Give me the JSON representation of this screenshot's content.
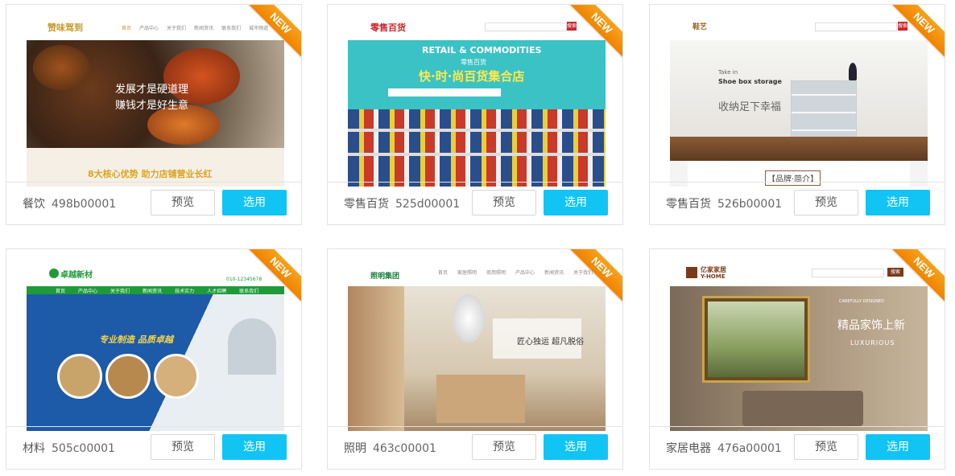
{
  "ribbon_label": "NEW",
  "buttons": {
    "preview": "预览",
    "select": "选用"
  },
  "colors": {
    "select_button": "#12c4f4",
    "ribbon": "#f08300",
    "border": "#e3e3e3"
  },
  "cards": [
    {
      "category": "餐饮",
      "code": "498b00001",
      "thumb": {
        "logo": "赞味驾到",
        "nav": [
          "首页",
          "产品中心",
          "关于我们",
          "新闻资讯",
          "联系我们",
          "城市频道"
        ],
        "headline1": "发展才是硬道理",
        "headline2": "赚钱才是好生意",
        "footer_text": "8大核心优势 助力店铺营业长红"
      }
    },
    {
      "category": "零售百货",
      "code": "525d00001",
      "thumb": {
        "logo": "零售百货",
        "search_btn": "搜索",
        "banner_en": "RETAIL & COMMODITIES",
        "banner_sub": "零售百货",
        "banner_main": "快·时·尚百货集合店"
      }
    },
    {
      "category": "零售百货",
      "code": "526b00001",
      "thumb": {
        "logo": "鞋艺",
        "search_btn": "搜索",
        "line1": "Take in",
        "line2": "Shoe box storage",
        "slogan": "收纳足下幸福",
        "section": "【品牌·简介】"
      }
    },
    {
      "category": "材料",
      "code": "505c00001",
      "thumb": {
        "logo": "卓越新材",
        "phone": "010-12345678",
        "nav": [
          "首页",
          "产品中心",
          "关于我们",
          "新闻资讯",
          "技术实力",
          "人才招聘",
          "联系我们"
        ],
        "slogan": "专业制造 品质卓越"
      }
    },
    {
      "category": "照明",
      "code": "463c00001",
      "thumb": {
        "logo": "照明集团",
        "nav": [
          "首页",
          "家居照明",
          "商用照明",
          "产品中心",
          "新闻资讯",
          "关于我们"
        ],
        "slogan": "匠心独运 超凡脱俗"
      }
    },
    {
      "category": "家居电器",
      "code": "476a00001",
      "thumb": {
        "logo": "亿家家居",
        "logo_en": "Y-HOME",
        "search_btn": "搜索",
        "small": "CAREFULLY DESIGNED",
        "headline": "精品家饰上新",
        "en": "LUXURIOUS"
      }
    }
  ]
}
